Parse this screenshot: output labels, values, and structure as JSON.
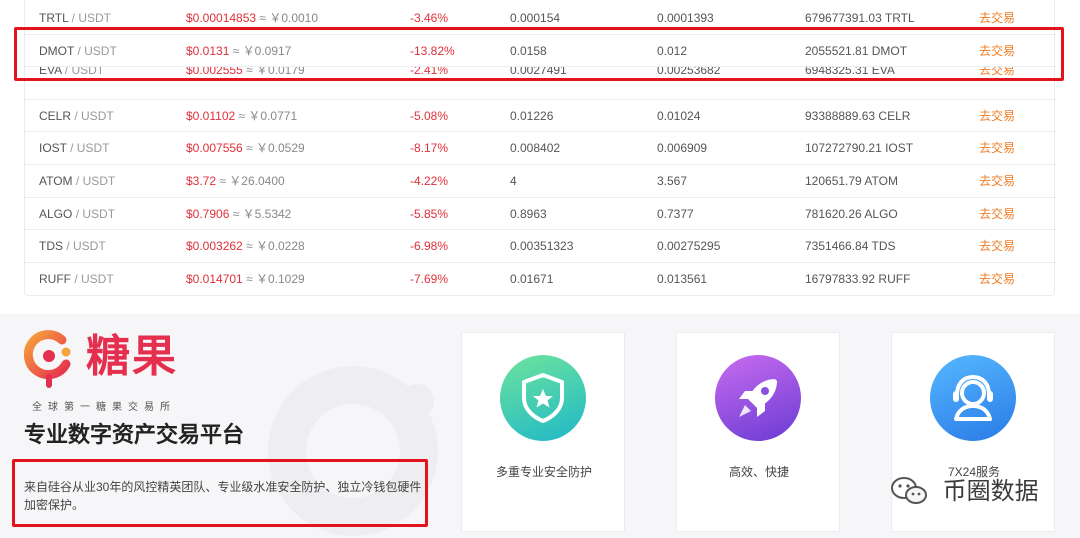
{
  "market": {
    "rows": [
      {
        "base": "TRTL",
        "quote": "USDT",
        "price": "$0.00014853",
        "cny": "≈ ￥0.0010",
        "change": "-3.46%",
        "high": "0.000154",
        "low": "0.0001393",
        "volume": "679677391.03 TRTL",
        "action": "去交易"
      },
      {
        "base": "DMOT",
        "quote": "USDT",
        "price": "$0.0131",
        "cny": "≈ ￥0.0917",
        "change": "-13.82%",
        "high": "0.0158",
        "low": "0.012",
        "volume": "2055521.81 DMOT",
        "action": "去交易"
      },
      {
        "base": "EVA",
        "quote": "USDT",
        "price": "$0.002555",
        "cny": "≈ ￥0.0179",
        "change": "-2.41%",
        "high": "0.0027491",
        "low": "0.00253682",
        "volume": "6948325.31 EVA",
        "action": "去交易"
      },
      {
        "base": "CELR",
        "quote": "USDT",
        "price": "$0.01102",
        "cny": "≈ ￥0.0771",
        "change": "-5.08%",
        "high": "0.01226",
        "low": "0.01024",
        "volume": "93388889.63 CELR",
        "action": "去交易"
      },
      {
        "base": "IOST",
        "quote": "USDT",
        "price": "$0.007556",
        "cny": "≈ ￥0.0529",
        "change": "-8.17%",
        "high": "0.008402",
        "low": "0.006909",
        "volume": "107272790.21 IOST",
        "action": "去交易"
      },
      {
        "base": "ATOM",
        "quote": "USDT",
        "price": "$3.72",
        "cny": "≈ ￥26.0400",
        "change": "-4.22%",
        "high": "4",
        "low": "3.567",
        "volume": "120651.79 ATOM",
        "action": "去交易"
      },
      {
        "base": "ALGO",
        "quote": "USDT",
        "price": "$0.7906",
        "cny": "≈ ￥5.5342",
        "change": "-5.85%",
        "high": "0.8963",
        "low": "0.7377",
        "volume": "781620.26 ALGO",
        "action": "去交易"
      },
      {
        "base": "TDS",
        "quote": "USDT",
        "price": "$0.003262",
        "cny": "≈ ￥0.0228",
        "change": "-6.98%",
        "high": "0.00351323",
        "low": "0.00275295",
        "volume": "7351466.84 TDS",
        "action": "去交易"
      },
      {
        "base": "RUFF",
        "quote": "USDT",
        "price": "$0.014701",
        "cny": "≈ ￥0.1029",
        "change": "-7.69%",
        "high": "0.01671",
        "low": "0.013561",
        "volume": "16797833.92 RUFF",
        "action": "去交易"
      }
    ],
    "pair_separator": " / "
  },
  "brand": {
    "name": "糖果",
    "tagline": "全球第一糖果交易所",
    "title": "专业数字资产交易平台",
    "description": "来自硅谷从业30年的风控精英团队、专业级水准安全防护、独立冷钱包硬件加密保护。",
    "accent_color": "#e52f4e"
  },
  "features": [
    {
      "label": "多重专业安全防护",
      "icon": "shield-star-icon"
    },
    {
      "label": "高效、快捷",
      "icon": "rocket-icon"
    },
    {
      "label": "7X24服务",
      "icon": "headset-agent-icon"
    }
  ],
  "watermark": {
    "text": "币圈数据",
    "icon": "wechat-icon"
  },
  "colors": {
    "price_red": "#e0303a",
    "trade_orange": "#f07b22",
    "annotation_red": "#e3131b"
  }
}
